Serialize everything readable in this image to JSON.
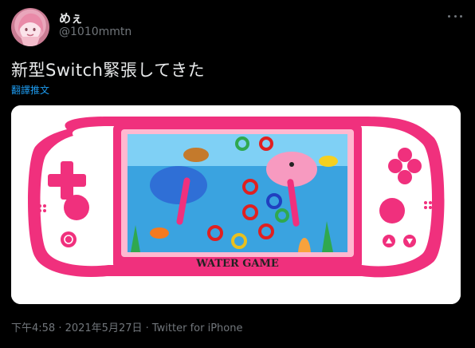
{
  "tweet": {
    "display_name": "めぇ",
    "handle": "@1010mmtn",
    "text": "新型Switch緊張してきた",
    "translate_label": "翻譯推文",
    "timestamp": "下午4:58 · 2021年5月27日 · Twitter for iPhone"
  },
  "media": {
    "label_text": "WATER GAME"
  },
  "icons": {
    "more": "more-icon",
    "avatar": "avatar-image"
  },
  "colors": {
    "background": "#000000",
    "text": "#e7e9ea",
    "muted": "#71767b",
    "link": "#1d9bf0",
    "console_pink": "#f0307d",
    "water": "#3aa3e0"
  }
}
